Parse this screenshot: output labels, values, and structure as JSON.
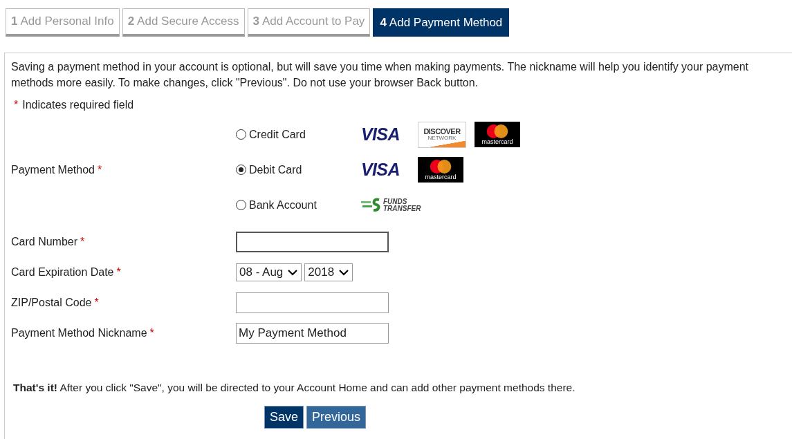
{
  "tabs": [
    {
      "number": "1",
      "label": "Add Personal Info",
      "selected": false
    },
    {
      "number": "2",
      "label": "Add Secure Access",
      "selected": false
    },
    {
      "number": "3",
      "label": "Add Account to Pay",
      "selected": false
    },
    {
      "number": "4",
      "label": "Add Payment Method",
      "selected": true
    }
  ],
  "intro": "Saving a payment method in your account is optional, but will save you time when making payments. The nickname will help you identify your payment methods more easily. To make changes, click \"Previous\". Do not use your browser Back button.",
  "required_note": {
    "mark": "*",
    "text": "Indicates required field"
  },
  "payment_method": {
    "label": "Payment Method",
    "required_mark": "*",
    "options": [
      {
        "label": "Credit Card",
        "selected": false,
        "logos": [
          {
            "kind": "visa",
            "text": "VISA"
          },
          {
            "kind": "discover",
            "text": "DISCOVER",
            "subtext": "NETWORK"
          },
          {
            "kind": "mastercard",
            "text": "mastercard"
          }
        ]
      },
      {
        "label": "Debit Card",
        "selected": true,
        "logos": [
          {
            "kind": "visa",
            "text": "VISA"
          },
          {
            "kind": "mastercard",
            "text": "mastercard"
          }
        ]
      },
      {
        "label": "Bank Account",
        "selected": false,
        "logos": [
          {
            "kind": "funds",
            "text": "FUNDS",
            "subtext": "TRANSFER"
          }
        ]
      }
    ]
  },
  "fields": [
    {
      "kind": "text",
      "label": "Card Number",
      "required_mark": "*"
    },
    {
      "kind": "selects",
      "label": "Card Expiration Date",
      "required_mark": "*",
      "selects": [
        {
          "value": "08 - Aug"
        },
        {
          "value": "2018"
        }
      ]
    },
    {
      "kind": "text",
      "label": "ZIP/Postal Code",
      "required_mark": "*"
    },
    {
      "kind": "text",
      "label": "Payment Method Nickname",
      "required_mark": "*",
      "value": "My Payment Method"
    }
  ],
  "footer": "**That's it!** After you click \"Save\", you will be directed to your Account Home and can add other payment methods there.",
  "buttons": [
    {
      "label": "Save",
      "kind": "primary"
    },
    {
      "label": "Previous",
      "kind": "secondary"
    }
  ]
}
